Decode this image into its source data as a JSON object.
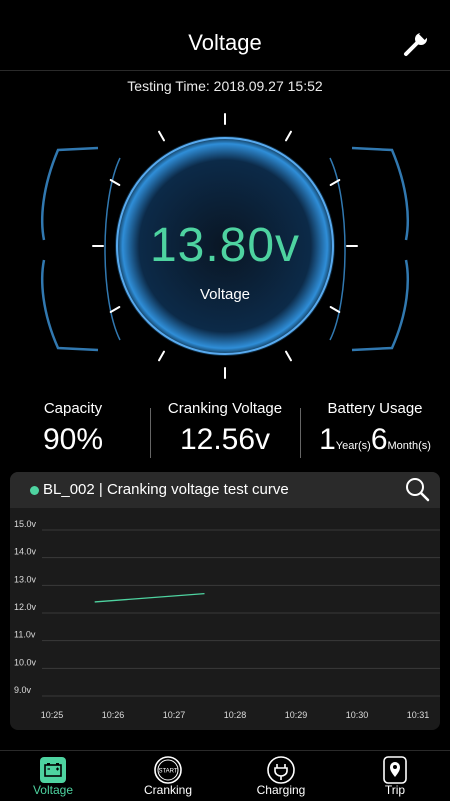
{
  "header": {
    "title": "Voltage",
    "settings_icon": "wrench-icon"
  },
  "testing": {
    "label": "Testing Time:",
    "date": "2018.09.27",
    "time": "15:52"
  },
  "gauge": {
    "value": "13.80v",
    "label": "Voltage",
    "color": "#4ed3a0"
  },
  "stats": {
    "capacity": {
      "label": "Capacity",
      "value": "90%"
    },
    "cranking": {
      "label": "Cranking Voltage",
      "value": "12.56v"
    },
    "usage": {
      "label": "Battery Usage",
      "years": "1",
      "years_unit": "Year(s)",
      "months": "6",
      "months_unit": "Month(s)"
    }
  },
  "card": {
    "battery_id": "BL_002",
    "title": "Cranking voltage test curve",
    "search_icon": "search-icon"
  },
  "chart_data": {
    "type": "line",
    "title": "Cranking voltage test curve",
    "x_ticks": [
      "10:25",
      "10:26",
      "10:27",
      "10:28",
      "10:29",
      "10:30",
      "10:31"
    ],
    "y_ticks": [
      "15.0v",
      "14.0v",
      "13.0v",
      "12.0v",
      "11.0v",
      "10.0v",
      "9.0v"
    ],
    "ylim": [
      9.0,
      15.0
    ],
    "grid": true,
    "series": [
      {
        "x": [
          "10:25.7",
          "10:27.5"
        ],
        "y": [
          12.4,
          12.7
        ],
        "color": "#4ed3a0"
      }
    ]
  },
  "tabs": [
    {
      "label": "Voltage",
      "icon": "battery-icon",
      "active": true
    },
    {
      "label": "Cranking",
      "icon": "start-icon",
      "active": false
    },
    {
      "label": "Charging",
      "icon": "plug-icon",
      "active": false
    },
    {
      "label": "Trip",
      "icon": "map-pin-icon",
      "active": false
    }
  ],
  "tab_icon_text": {
    "start": "START"
  }
}
